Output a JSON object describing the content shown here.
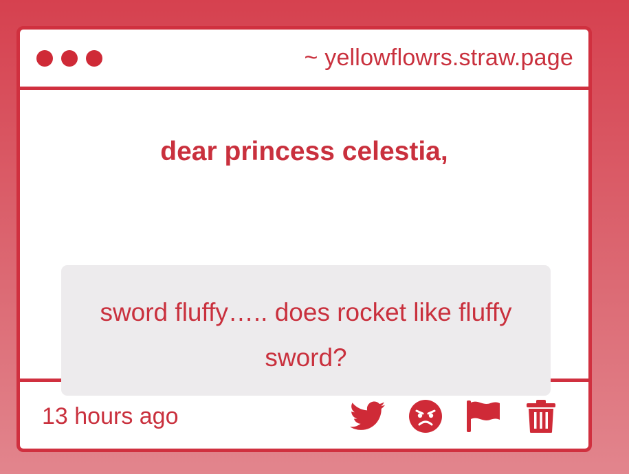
{
  "titlebar": {
    "url": "~ yellowflowrs.straw.page"
  },
  "letter": {
    "heading": "dear princess celestia,",
    "message": "sword fluffy….. does rocket like fluffy sword?"
  },
  "footer": {
    "timestamp": "13 hours ago",
    "actions": [
      {
        "icon": "twitter-icon"
      },
      {
        "icon": "angry-face-icon"
      },
      {
        "icon": "flag-icon"
      },
      {
        "icon": "trash-icon"
      }
    ]
  },
  "colors": {
    "accent": "#d0303f",
    "message_bg": "#edebed",
    "card_bg": "#ffffff"
  }
}
